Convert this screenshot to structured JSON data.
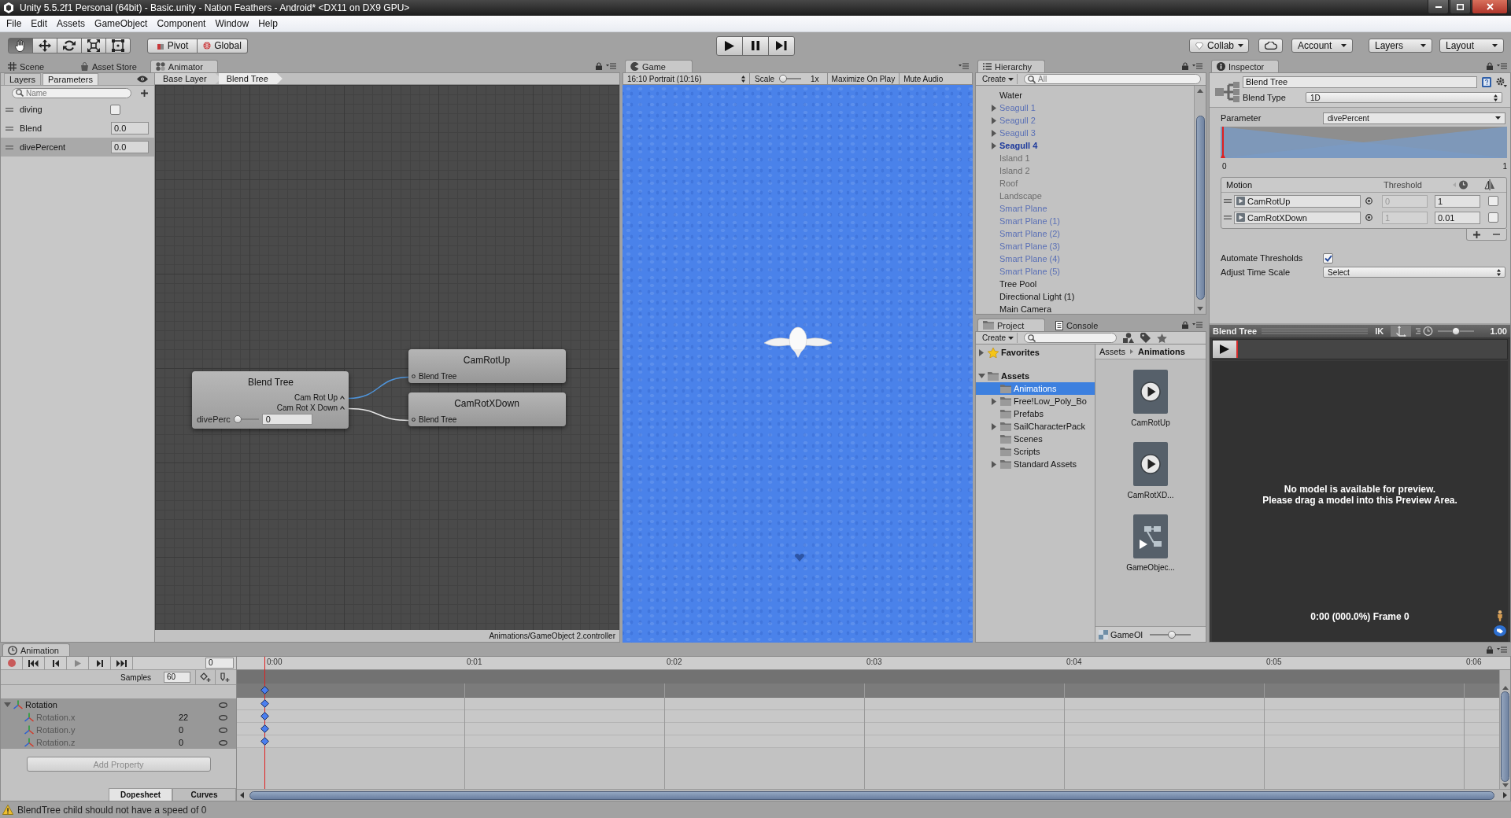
{
  "window": {
    "title": "Unity 5.5.2f1 Personal (64bit) - Basic.unity - Nation Feathers - Android* <DX11 on DX9 GPU>"
  },
  "menu": [
    "File",
    "Edit",
    "Assets",
    "GameObject",
    "Component",
    "Window",
    "Help"
  ],
  "toolbar": {
    "tools": [
      {
        "kind": "hand",
        "selected": true
      },
      {
        "kind": "move",
        "selected": false
      },
      {
        "kind": "rotate",
        "selected": false
      },
      {
        "kind": "scale",
        "selected": false
      },
      {
        "kind": "rect",
        "selected": false
      }
    ],
    "pivot": "Pivot",
    "space": "Global",
    "playback": [
      {
        "kind": "play"
      },
      {
        "kind": "pause"
      },
      {
        "kind": "step"
      }
    ],
    "collab": "Collab",
    "account": "Account",
    "layers": "Layers",
    "layout": "Layout"
  },
  "left_dock": {
    "tabs": [
      {
        "label": "Scene",
        "kind": "scene",
        "selected": false
      },
      {
        "label": "Asset Store",
        "kind": "store",
        "selected": false
      },
      {
        "label": "Animator",
        "kind": "animator",
        "selected": true
      }
    ]
  },
  "animator": {
    "sidebar_tabs": [
      {
        "label": "Layers",
        "selected": false
      },
      {
        "label": "Parameters",
        "selected": true
      }
    ],
    "search": {
      "placeholder": "Name"
    },
    "parameters": [
      {
        "name": "diving",
        "kind": "bool",
        "checked": false,
        "selected": false
      },
      {
        "name": "Blend",
        "kind": "float",
        "value": "0.0",
        "selected": false
      },
      {
        "name": "divePercent",
        "kind": "float",
        "value": "0.0",
        "selected": true
      }
    ],
    "breadcrumbs": [
      "Base Layer",
      "Blend Tree"
    ],
    "blend_node": {
      "title": "Blend Tree",
      "outputs": [
        "Cam Rot Up",
        "Cam Rot X Down"
      ],
      "parameter": "divePerc",
      "level": 0,
      "value": "0"
    },
    "child_nodes": [
      {
        "title": "CamRotUp",
        "input": "Blend Tree",
        "highlighted": true
      },
      {
        "title": "CamRotXDown",
        "input": "Blend Tree",
        "highlighted": false
      }
    ],
    "controller_path": "Animations/GameObject 2.controller"
  },
  "game": {
    "tabs": [
      {
        "label": "Game",
        "kind": "game",
        "selected": true
      }
    ],
    "aspect": "16:10 Portrait (10:16)",
    "scale_label": "Scale",
    "scale": {
      "level": 0
    },
    "scale_value": "1x",
    "maximize": "Maximize On Play",
    "mute": "Mute Audio"
  },
  "hierarchy": {
    "tabs": [
      {
        "label": "Hierarchy",
        "kind": "hierarchy",
        "selected": true
      }
    ],
    "create": "Create",
    "search": {
      "placeholder": "All"
    },
    "items": [
      {
        "name": "Water",
        "kind": "object",
        "active": true,
        "bold": false
      },
      {
        "name": "Seagull 1",
        "kind": "prefab",
        "active": false,
        "bold": false,
        "expanded": false
      },
      {
        "name": "Seagull 2",
        "kind": "prefab",
        "active": false,
        "bold": false,
        "expanded": false
      },
      {
        "name": "Seagull 3",
        "kind": "prefab",
        "active": false,
        "bold": false,
        "expanded": false
      },
      {
        "name": "Seagull 4",
        "kind": "prefab",
        "active": true,
        "bold": true,
        "expanded": false
      },
      {
        "name": "Island 1",
        "kind": "object",
        "active": false,
        "bold": false
      },
      {
        "name": "Island 2",
        "kind": "object",
        "active": false,
        "bold": false
      },
      {
        "name": "Roof",
        "kind": "object",
        "active": false,
        "bold": false
      },
      {
        "name": "Landscape",
        "kind": "object",
        "active": false,
        "bold": false
      },
      {
        "name": "Smart Plane",
        "kind": "prefab",
        "active": false,
        "bold": false
      },
      {
        "name": "Smart Plane (1)",
        "kind": "prefab",
        "active": false,
        "bold": false
      },
      {
        "name": "Smart Plane (2)",
        "kind": "prefab",
        "active": false,
        "bold": false
      },
      {
        "name": "Smart Plane (3)",
        "kind": "prefab",
        "active": false,
        "bold": false
      },
      {
        "name": "Smart Plane (4)",
        "kind": "prefab",
        "active": false,
        "bold": false
      },
      {
        "name": "Smart Plane (5)",
        "kind": "prefab",
        "active": false,
        "bold": false
      },
      {
        "name": "Tree Pool",
        "kind": "object",
        "active": true,
        "bold": false
      },
      {
        "name": "Directional Light (1)",
        "kind": "object",
        "active": true,
        "bold": false
      },
      {
        "name": "Main Camera",
        "kind": "object",
        "active": true,
        "bold": false
      }
    ]
  },
  "project": {
    "tabs": [
      {
        "label": "Project",
        "kind": "project",
        "selected": true
      },
      {
        "label": "Console",
        "kind": "console",
        "selected": false
      }
    ],
    "create": "Create",
    "tree": [
      {
        "name": "Favorites",
        "kind": "favorites",
        "expanded": false,
        "selected": false
      },
      {
        "name": "Assets",
        "kind": "folder",
        "expanded": true,
        "selected": false,
        "children": [
          {
            "name": "Animations",
            "kind": "folder",
            "selected": true
          },
          {
            "name": "Free!Low_Poly_Bo",
            "kind": "folder",
            "expanded": false,
            "selected": false
          },
          {
            "name": "Prefabs",
            "kind": "folder",
            "selected": false
          },
          {
            "name": "SailCharacterPack",
            "kind": "folder",
            "expanded": false,
            "selected": false
          },
          {
            "name": "Scenes",
            "kind": "folder",
            "selected": false
          },
          {
            "name": "Scripts",
            "kind": "folder",
            "selected": false
          },
          {
            "name": "Standard Assets",
            "kind": "folder",
            "expanded": false,
            "selected": false
          }
        ]
      }
    ],
    "breadcrumbs": [
      "Assets",
      "Animations"
    ],
    "assets": [
      {
        "name": "CamRotUp",
        "kind": "clip"
      },
      {
        "name": "CamRotXD...",
        "kind": "clip"
      },
      {
        "name": "GameObjec...",
        "kind": "controller"
      }
    ],
    "footer": "GameOl",
    "icon_size": {
      "level": 0.55
    }
  },
  "inspector": {
    "tabs": [
      {
        "label": "Inspector",
        "kind": "inspector",
        "selected": true
      }
    ],
    "name": "Blend Tree",
    "blend_type_label": "Blend Type",
    "blend_type": "1D",
    "parameter_label": "Parameter",
    "parameter": "divePercent",
    "graph": {
      "min": "0",
      "max": "1",
      "level": 0
    },
    "motion_header": "Motion",
    "threshold_header": "Threshold",
    "motions": [
      {
        "name": "CamRotUp",
        "threshold": "0",
        "time_scale": "1",
        "checked": false
      },
      {
        "name": "CamRotXDown",
        "threshold": "1",
        "time_scale": "0.01",
        "checked": false
      }
    ],
    "automate_label": "Automate Thresholds",
    "automate": true,
    "time_scale_label": "Adjust Time Scale",
    "time_scale_value": "Select"
  },
  "preview": {
    "title": "Blend Tree",
    "ik": "IK",
    "pivot": {
      "on": true
    },
    "speed": {
      "level": 0.5
    },
    "speed_value": "1.00",
    "message": [
      "No model is available for preview.",
      "Please drag a model into this Preview Area."
    ],
    "time": "0:00 (000.0%) Frame 0"
  },
  "animation": {
    "tabs": [
      {
        "label": "Animation",
        "kind": "animation",
        "selected": true
      }
    ],
    "controls": [
      {
        "kind": "record"
      },
      {
        "kind": "first"
      },
      {
        "kind": "prev"
      },
      {
        "kind": "play"
      },
      {
        "kind": "next"
      },
      {
        "kind": "last"
      }
    ],
    "frame": "0",
    "samples_label": "Samples",
    "samples": "60",
    "properties": [
      {
        "name": "Rotation",
        "expanded": true,
        "children": [
          {
            "name": "Rotation.x",
            "value": "22"
          },
          {
            "name": "Rotation.y",
            "value": "0"
          },
          {
            "name": "Rotation.z",
            "value": "0"
          }
        ]
      }
    ],
    "add_property": {
      "label": "Add Property",
      "disabled": true
    },
    "view_tabs": [
      {
        "label": "Dopesheet",
        "selected": true
      },
      {
        "label": "Curves",
        "selected": false
      }
    ],
    "ticks": [
      "0:00",
      "0:01",
      "0:02",
      "0:03",
      "0:04",
      "0:05",
      "0:06"
    ]
  },
  "status_bar": {
    "kind": "warning",
    "message": "BlendTree child should not have a speed of 0"
  }
}
